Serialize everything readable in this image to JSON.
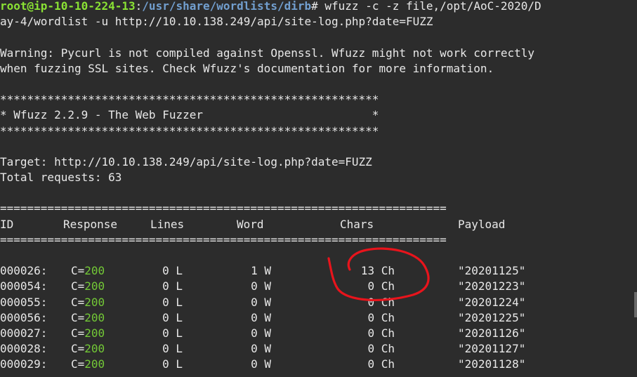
{
  "terminal": {
    "prompt": {
      "user_host": "root@ip-10-10-224-13",
      "separator": ":",
      "path": "/usr/share/wordlists/dirb",
      "symbol": "#"
    },
    "command_line_1": " wfuzz -c -z file,/opt/AoC-2020/D",
    "command_line_2": "ay-4/wordlist -u http://10.10.138.249/api/site-log.php?date=FUZZ",
    "warning_1": "Warning: Pycurl is not compiled against Openssl. Wfuzz might not work correctly",
    "warning_2": "when fuzzing SSL sites. Check Wfuzz's documentation for more information.",
    "banner_stars": "********************************************************",
    "banner_title": "* Wfuzz 2.2.9 - The Web Fuzzer                         *",
    "target": "Target: http://10.10.138.249/api/site-log.php?date=FUZZ",
    "total_requests": "Total requests: 63",
    "rule": "==================================================================",
    "headers": {
      "id": "ID",
      "response": "Response",
      "lines": "Lines",
      "word": "Word",
      "chars": "Chars",
      "payload": "Payload"
    },
    "rows": [
      {
        "id": "000026:",
        "code_prefix": "C=",
        "code": "200",
        "lines": "0 L",
        "words": "1 W",
        "chars": "13 Ch",
        "payload": "\"20201125\""
      },
      {
        "id": "000054:",
        "code_prefix": "C=",
        "code": "200",
        "lines": "0 L",
        "words": "0 W",
        "chars": "0 Ch",
        "payload": "\"20201223\""
      },
      {
        "id": "000055:",
        "code_prefix": "C=",
        "code": "200",
        "lines": "0 L",
        "words": "0 W",
        "chars": "0 Ch",
        "payload": "\"20201224\""
      },
      {
        "id": "000056:",
        "code_prefix": "C=",
        "code": "200",
        "lines": "0 L",
        "words": "0 W",
        "chars": "0 Ch",
        "payload": "\"20201225\""
      },
      {
        "id": "000027:",
        "code_prefix": "C=",
        "code": "200",
        "lines": "0 L",
        "words": "0 W",
        "chars": "0 Ch",
        "payload": "\"20201126\""
      },
      {
        "id": "000028:",
        "code_prefix": "C=",
        "code": "200",
        "lines": "0 L",
        "words": "0 W",
        "chars": "0 Ch",
        "payload": "\"20201127\""
      },
      {
        "id": "000029:",
        "code_prefix": "C=",
        "code": "200",
        "lines": "0 L",
        "words": "0 W",
        "chars": "0 Ch",
        "payload": "\"20201128\""
      }
    ],
    "colors": {
      "background": "#2c2c2c",
      "prompt_user": "#8ae234",
      "prompt_path": "#729fcf",
      "status_ok": "#73c936",
      "annotation": "#e8141c"
    }
  }
}
